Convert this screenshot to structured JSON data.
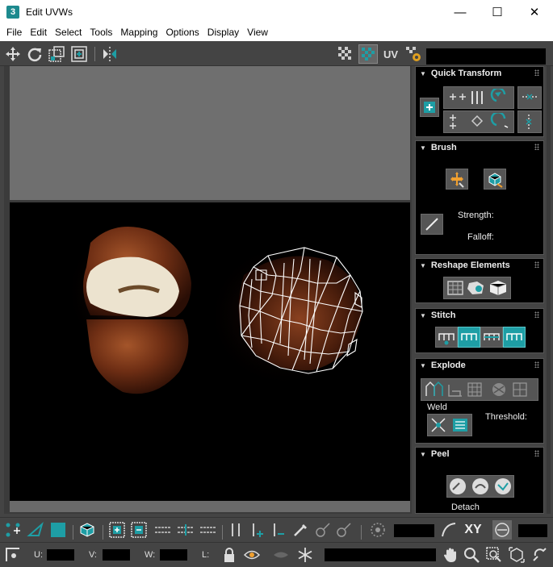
{
  "window": {
    "title": "Edit UVWs",
    "app_icon_text": "3",
    "controls": {
      "minimize": "—",
      "maximize": "☐",
      "close": "✕"
    }
  },
  "menu": {
    "items": [
      "File",
      "Edit",
      "Select",
      "Tools",
      "Mapping",
      "Options",
      "Display",
      "View"
    ]
  },
  "toolbar": {
    "uv_label": "UV"
  },
  "panel": {
    "quick_transform": {
      "title": "Quick Transform"
    },
    "brush": {
      "title": "Brush",
      "strength_label": "Strength:",
      "falloff_label": "Falloff:"
    },
    "reshape": {
      "title": "Reshape Elements"
    },
    "stitch": {
      "title": "Stitch"
    },
    "explode": {
      "title": "Explode",
      "weld_label": "Weld",
      "threshold_label": "Threshold:"
    },
    "peel": {
      "title": "Peel",
      "detach_label": "Detach"
    }
  },
  "bottom": {
    "xy_label": "XY",
    "u_label": "U:",
    "v_label": "V:",
    "w_label": "W:",
    "l_label": "L:"
  },
  "colors": {
    "accent_teal": "#1e9ea5",
    "wire": "#ffffff",
    "texture_brown": "#5a2a14"
  }
}
